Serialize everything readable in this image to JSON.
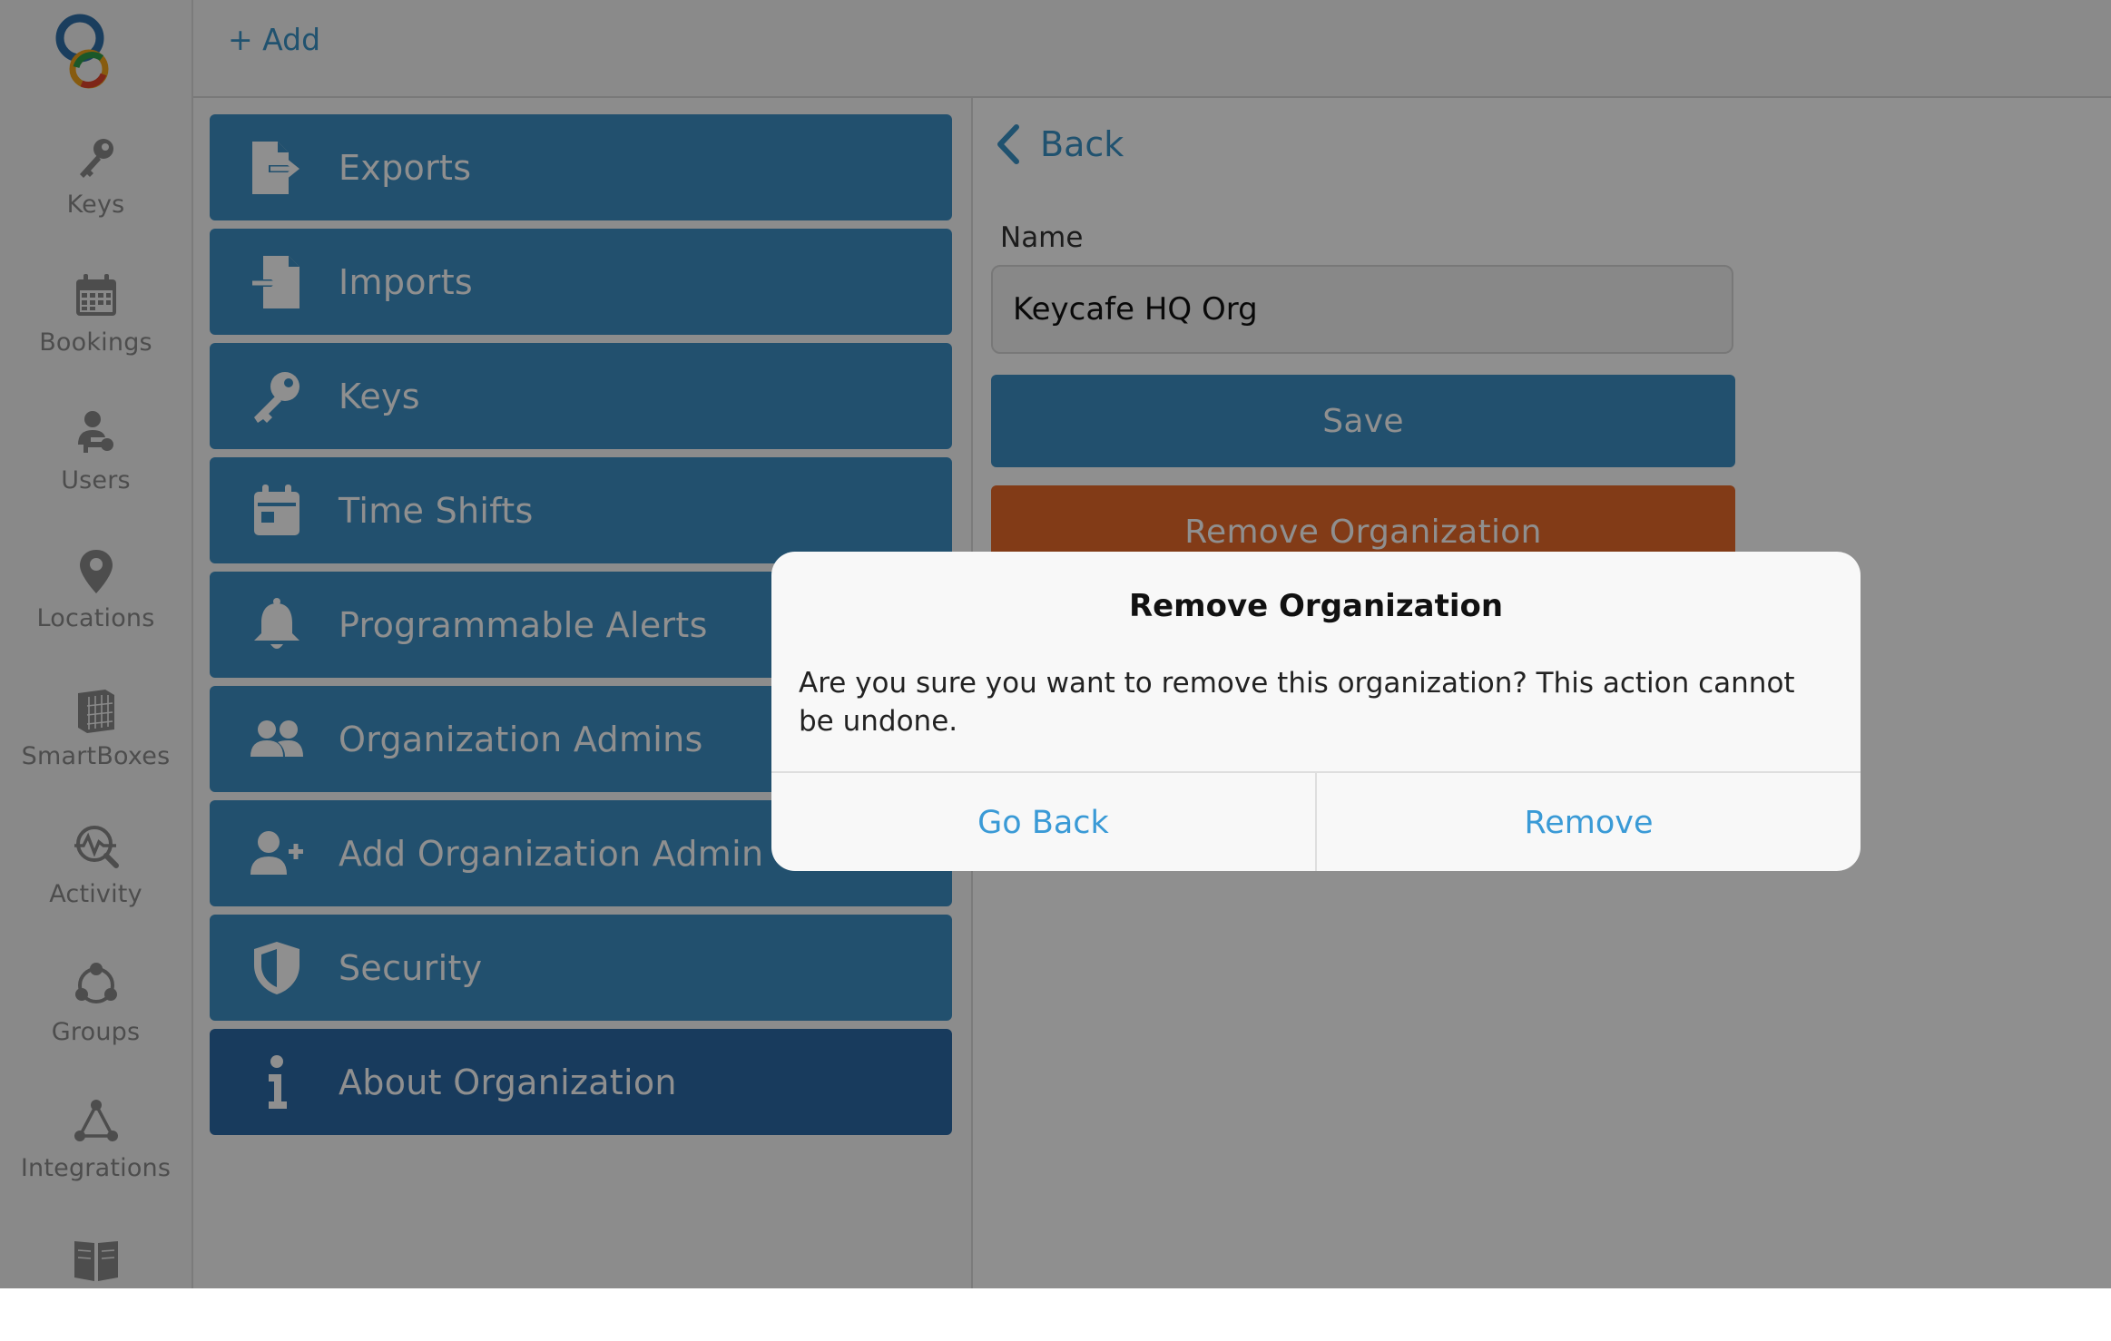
{
  "app": {
    "logo": "keycafe-logo"
  },
  "rail": {
    "items": [
      {
        "label": "Keys",
        "icon": "key-icon"
      },
      {
        "label": "Bookings",
        "icon": "calendar-icon"
      },
      {
        "label": "Users",
        "icon": "user-key-icon"
      },
      {
        "label": "Locations",
        "icon": "map-pin-icon"
      },
      {
        "label": "SmartBoxes",
        "icon": "smartbox-icon"
      },
      {
        "label": "Activity",
        "icon": "activity-icon"
      },
      {
        "label": "Groups",
        "icon": "groups-icon"
      },
      {
        "label": "Integrations",
        "icon": "integrations-icon"
      },
      {
        "label": "",
        "icon": "book-icon"
      }
    ]
  },
  "topbar": {
    "add_label": "+ Add"
  },
  "menu": {
    "items": [
      {
        "label": "Exports",
        "icon": "export-file-icon"
      },
      {
        "label": "Imports",
        "icon": "import-file-icon"
      },
      {
        "label": "Keys",
        "icon": "key-icon"
      },
      {
        "label": "Time Shifts",
        "icon": "calendar-icon"
      },
      {
        "label": "Programmable Alerts",
        "icon": "bell-icon"
      },
      {
        "label": "Organization Admins",
        "icon": "users-icon"
      },
      {
        "label": "Add Organization Admin",
        "icon": "user-plus-icon"
      },
      {
        "label": "Security",
        "icon": "shield-icon"
      },
      {
        "label": "About Organization",
        "icon": "info-icon",
        "active": true
      }
    ]
  },
  "detail": {
    "back_label": "Back",
    "name_label": "Name",
    "name_value": "Keycafe HQ Org",
    "save_label": "Save",
    "remove_label": "Remove Organization"
  },
  "dialog": {
    "title": "Remove Organization",
    "message": "Are you sure you want to remove this organization? This action cannot be undone.",
    "cancel_label": "Go Back",
    "confirm_label": "Remove"
  },
  "colors": {
    "accent": "#3d8fc4",
    "active_menu": "#2c6aa6",
    "danger": "#e8692a",
    "link": "#3a92c7"
  }
}
